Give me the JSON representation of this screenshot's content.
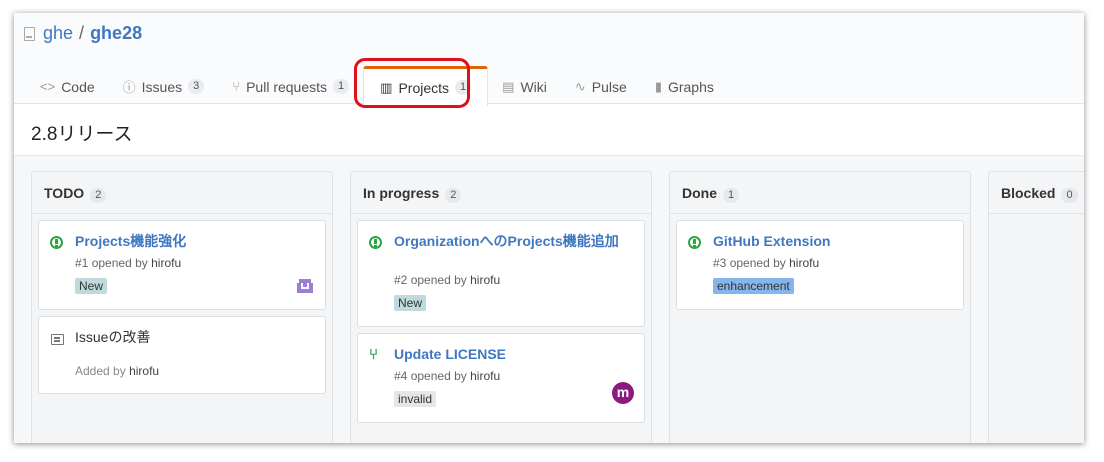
{
  "repo": {
    "owner": "ghe",
    "separator": "/",
    "name": "ghe28"
  },
  "nav": {
    "code": {
      "icon": "code-icon",
      "label": "Code"
    },
    "issues": {
      "icon": "issue-icon",
      "label": "Issues",
      "count": "3"
    },
    "pulls": {
      "icon": "pull-request-icon",
      "label": "Pull requests",
      "count": "1"
    },
    "projects": {
      "icon": "project-icon",
      "label": "Projects",
      "count": "1",
      "selected": true
    },
    "wiki": {
      "icon": "book-icon",
      "label": "Wiki"
    },
    "pulse": {
      "icon": "pulse-icon",
      "label": "Pulse"
    },
    "graphs": {
      "icon": "graph-icon",
      "label": "Graphs"
    }
  },
  "project": {
    "title": "2.8リリース"
  },
  "columns": [
    {
      "name": "TODO",
      "count": "2",
      "cards": [
        {
          "type": "issue",
          "title": "Projects機能強化",
          "number": "#1",
          "opened_by": "opened by",
          "user": "hirofu",
          "label": "New",
          "label_color": "#bfdadc"
        },
        {
          "type": "note",
          "title": "Issueの改善",
          "added_by": "Added by",
          "user": "hirofu"
        }
      ]
    },
    {
      "name": "In progress",
      "count": "2",
      "cards": [
        {
          "type": "issue",
          "title": "OrganizationへのProjects機能追加",
          "number": "#2",
          "opened_by": "opened by",
          "user": "hirofu",
          "label": "New",
          "label_color": "#bfdadc"
        },
        {
          "type": "pull-request",
          "title": "Update LICENSE",
          "number": "#4",
          "opened_by": "opened by",
          "user": "hirofu",
          "label": "invalid",
          "label_color": "#e6e6e6"
        }
      ]
    },
    {
      "name": "Done",
      "count": "1",
      "cards": [
        {
          "type": "issue",
          "title": "GitHub Extension",
          "number": "#3",
          "opened_by": "opened by",
          "user": "hirofu",
          "label": "enhancement",
          "label_color": "#84b6eb"
        }
      ]
    },
    {
      "name": "Blocked",
      "count": "0",
      "cards": []
    }
  ],
  "colors": {
    "link": "#4078c0",
    "open": "#28a745",
    "highlight": "#e0101a",
    "tab_accent": "#e36209",
    "avatar_m": "#8a1a7e"
  },
  "avatar_letter": "m"
}
